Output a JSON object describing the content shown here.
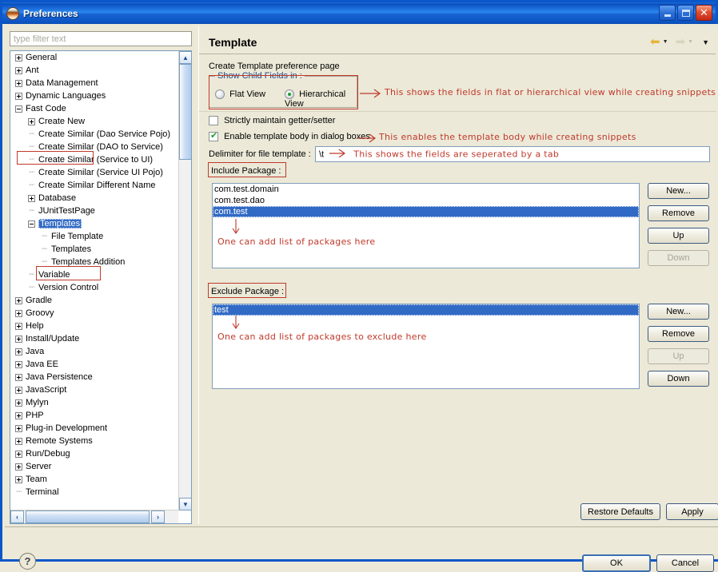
{
  "window": {
    "title": "Preferences",
    "icon": "preferences-icon",
    "minimize_label": "Minimize",
    "maximize_label": "Maximize",
    "close_label": "Close"
  },
  "filter": {
    "placeholder": "type filter text",
    "value": ""
  },
  "tree": {
    "items": [
      {
        "label": "General",
        "depth": 0,
        "twisty": "plus",
        "selected": false
      },
      {
        "label": "Ant",
        "depth": 0,
        "twisty": "plus",
        "selected": false
      },
      {
        "label": "Data Management",
        "depth": 0,
        "twisty": "plus",
        "selected": false
      },
      {
        "label": "Dynamic Languages",
        "depth": 0,
        "twisty": "plus",
        "selected": false
      },
      {
        "label": "Fast Code",
        "depth": 0,
        "twisty": "minus",
        "selected": false
      },
      {
        "label": "Create New",
        "depth": 1,
        "twisty": "plus",
        "selected": false
      },
      {
        "label": "Create Similar (Dao Service Pojo)",
        "depth": 1,
        "twisty": "leaf",
        "selected": false
      },
      {
        "label": "Create Similar (DAO to Service)",
        "depth": 1,
        "twisty": "leaf",
        "selected": false
      },
      {
        "label": "Create Similar (Service to UI)",
        "depth": 1,
        "twisty": "leaf",
        "selected": false
      },
      {
        "label": "Create Similar (Service UI Pojo)",
        "depth": 1,
        "twisty": "leaf",
        "selected": false
      },
      {
        "label": "Create Similar Different Name",
        "depth": 1,
        "twisty": "leaf",
        "selected": false
      },
      {
        "label": "Database",
        "depth": 1,
        "twisty": "plus",
        "selected": false
      },
      {
        "label": "JUnitTestPage",
        "depth": 1,
        "twisty": "leaf",
        "selected": false
      },
      {
        "label": "Templates",
        "depth": 1,
        "twisty": "minus",
        "selected": true
      },
      {
        "label": "File Template",
        "depth": 2,
        "twisty": "leaf",
        "selected": false
      },
      {
        "label": "Templates",
        "depth": 2,
        "twisty": "leaf",
        "selected": false
      },
      {
        "label": "Templates Addition",
        "depth": 2,
        "twisty": "leaf",
        "selected": false
      },
      {
        "label": "Variable",
        "depth": 1,
        "twisty": "leaf",
        "selected": false
      },
      {
        "label": "Version Control",
        "depth": 1,
        "twisty": "leaf",
        "selected": false
      },
      {
        "label": "Gradle",
        "depth": 0,
        "twisty": "plus",
        "selected": false
      },
      {
        "label": "Groovy",
        "depth": 0,
        "twisty": "plus",
        "selected": false
      },
      {
        "label": "Help",
        "depth": 0,
        "twisty": "plus",
        "selected": false
      },
      {
        "label": "Install/Update",
        "depth": 0,
        "twisty": "plus",
        "selected": false
      },
      {
        "label": "Java",
        "depth": 0,
        "twisty": "plus",
        "selected": false
      },
      {
        "label": "Java EE",
        "depth": 0,
        "twisty": "plus",
        "selected": false
      },
      {
        "label": "Java Persistence",
        "depth": 0,
        "twisty": "plus",
        "selected": false
      },
      {
        "label": "JavaScript",
        "depth": 0,
        "twisty": "plus",
        "selected": false
      },
      {
        "label": "Mylyn",
        "depth": 0,
        "twisty": "plus",
        "selected": false
      },
      {
        "label": "PHP",
        "depth": 0,
        "twisty": "plus",
        "selected": false
      },
      {
        "label": "Plug-in Development",
        "depth": 0,
        "twisty": "plus",
        "selected": false
      },
      {
        "label": "Remote Systems",
        "depth": 0,
        "twisty": "plus",
        "selected": false
      },
      {
        "label": "Run/Debug",
        "depth": 0,
        "twisty": "plus",
        "selected": false
      },
      {
        "label": "Server",
        "depth": 0,
        "twisty": "plus",
        "selected": false
      },
      {
        "label": "Team",
        "depth": 0,
        "twisty": "plus",
        "selected": false
      },
      {
        "label": "Terminal",
        "depth": 0,
        "twisty": "leaf",
        "selected": false
      }
    ]
  },
  "page": {
    "title": "Template",
    "description": "Create Template preference page",
    "nav_back": "◄",
    "nav_forward": "►",
    "nav_menu": "▼"
  },
  "child_fields_group": {
    "title": "Show Child Fields in :",
    "flat_label": "Flat View",
    "hierarchical_label": "Hierarchical View",
    "flat_checked": false,
    "hierarchical_checked": true,
    "annotation": "This shows the fields in flat or hierarchical view while creating snippets"
  },
  "options": {
    "strict_getter_setter_label": "Strictly maintain getter/setter",
    "strict_getter_setter_checked": false,
    "enable_template_body_label": "Enable template body in dialog boxes",
    "enable_template_body_checked": true,
    "enable_template_body_annotation": "This enables the template body while creating snippets",
    "delimiter_label": "Delimiter for file template :",
    "delimiter_value": "\\t",
    "delimiter_annotation": "This shows the fields are seperated by a tab"
  },
  "include_package": {
    "label": "Include Package :",
    "items": [
      "com.test.domain",
      "com.test.dao",
      "com.test"
    ],
    "selected_index": 2,
    "annotation": "One can add list of packages here",
    "buttons": [
      {
        "label": "New...",
        "enabled": true
      },
      {
        "label": "Remove",
        "enabled": true
      },
      {
        "label": "Up",
        "enabled": true
      },
      {
        "label": "Down",
        "enabled": false
      }
    ]
  },
  "exclude_package": {
    "label": "Exclude Package :",
    "items": [
      "test"
    ],
    "selected_index": 0,
    "annotation": "One can add list of packages to exclude here",
    "buttons": [
      {
        "label": "New...",
        "enabled": true
      },
      {
        "label": "Remove",
        "enabled": true
      },
      {
        "label": "Up",
        "enabled": false
      },
      {
        "label": "Down",
        "enabled": true
      }
    ]
  },
  "page_buttons": {
    "restore_defaults": "Restore Defaults",
    "apply": "Apply"
  },
  "dialog_buttons": {
    "help": "?",
    "ok": "OK",
    "cancel": "Cancel"
  },
  "colors": {
    "accent_blue": "#316ac5",
    "annotation_red": "#c0392b",
    "panel_bg": "#ece9d8",
    "group_title": "#1d4c8f",
    "radio_green": "#1e9e2f"
  }
}
